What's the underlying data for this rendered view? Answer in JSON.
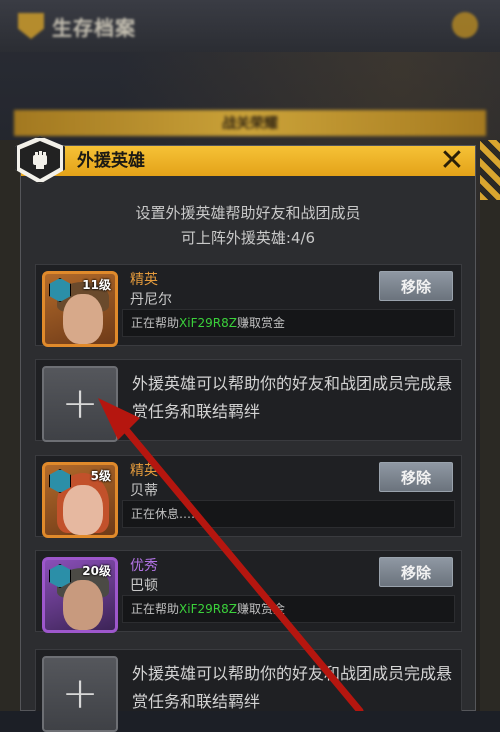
{
  "background": {
    "title": "生存档案",
    "banner": "战关荣耀"
  },
  "dialog": {
    "title": "外援英雄",
    "close_icon": "close-x-icon",
    "intro_line1": "设置外援英雄帮助好友和战团成员",
    "intro_line2": "可上阵外援英雄:4/6",
    "colors": {
      "header": "#f0b22a",
      "grade_elite": "#e39a3c",
      "grade_excellent": "#b173e3",
      "code": "#3bd13b"
    }
  },
  "slots": [
    {
      "type": "hero",
      "level": "11级",
      "grade": "精英",
      "name": "丹尼尔",
      "remove": "移除",
      "status_pre": "正在帮助",
      "status_code": "XiF29R8Z",
      "status_post": "赚取赏金"
    },
    {
      "type": "empty",
      "text": "外援英雄可以帮助你的好友和战团成员完成悬赏任务和联结羁绊"
    },
    {
      "type": "hero",
      "level": "5级",
      "grade": "精英",
      "name": "贝蒂",
      "remove": "移除",
      "status_pre": "正在休息……",
      "status_code": "",
      "status_post": ""
    },
    {
      "type": "hero",
      "level": "20级",
      "grade": "优秀",
      "name": "巴顿",
      "remove": "移除",
      "status_pre": "正在帮助",
      "status_code": "XiF29R8Z",
      "status_post": "赚取赏金"
    },
    {
      "type": "empty",
      "text": "外援英雄可以帮助你的好友和战团成员完成悬赏任务和联结羁绊"
    }
  ]
}
